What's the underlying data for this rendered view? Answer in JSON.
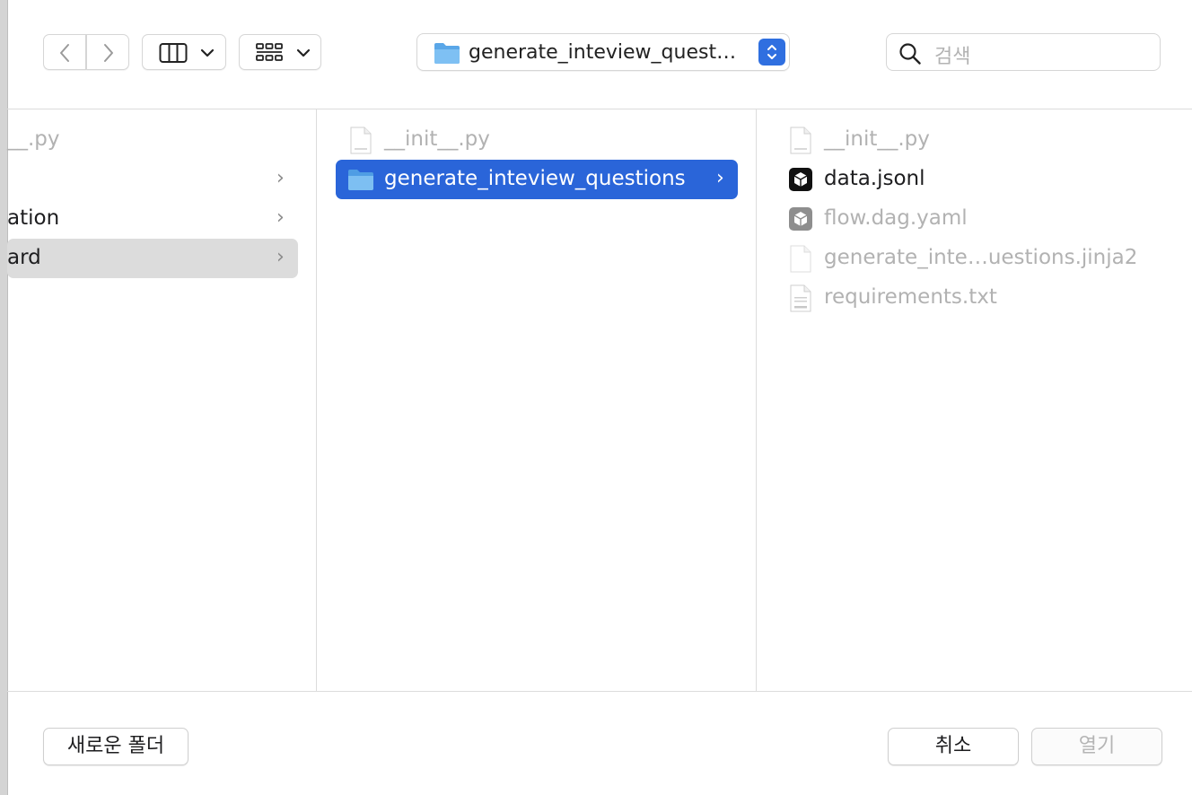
{
  "toolbar": {
    "back_icon": "chevron-left-icon",
    "forward_icon": "chevron-right-icon",
    "view_icon": "columns-view-icon",
    "group_icon": "grid-group-icon",
    "path_label": "generate_inteview_quest…",
    "search_placeholder": "검색"
  },
  "columns": {
    "col1": {
      "items": [
        {
          "label": "__.py",
          "dim": true,
          "chevron": false
        },
        {
          "label": "",
          "dim": false,
          "chevron": true
        },
        {
          "label": "ation",
          "dim": false,
          "chevron": true
        },
        {
          "label": "ard",
          "dim": false,
          "chevron": true,
          "highlighted": true
        }
      ]
    },
    "col2": {
      "items": [
        {
          "label": "__init__.py",
          "icon": "python-file-icon",
          "dim": true
        },
        {
          "label": "generate_inteview_questions",
          "icon": "folder-icon",
          "selected": true,
          "chevron": true
        }
      ]
    },
    "col3": {
      "items": [
        {
          "label": "__init__.py",
          "icon": "python-file-icon",
          "dim": true
        },
        {
          "label": "data.jsonl",
          "icon": "jsonl-file-icon",
          "dim": false
        },
        {
          "label": "flow.dag.yaml",
          "icon": "yaml-file-icon",
          "dim": true
        },
        {
          "label": "generate_inte…uestions.jinja2",
          "icon": "blank-file-icon",
          "dim": true
        },
        {
          "label": "requirements.txt",
          "icon": "txt-file-icon",
          "dim": true
        }
      ]
    }
  },
  "footer": {
    "new_folder": "새로운 폴더",
    "cancel": "취소",
    "open": "열기"
  },
  "colors": {
    "accent": "#2a65d9",
    "selection_gray": "#dcdcdc"
  }
}
